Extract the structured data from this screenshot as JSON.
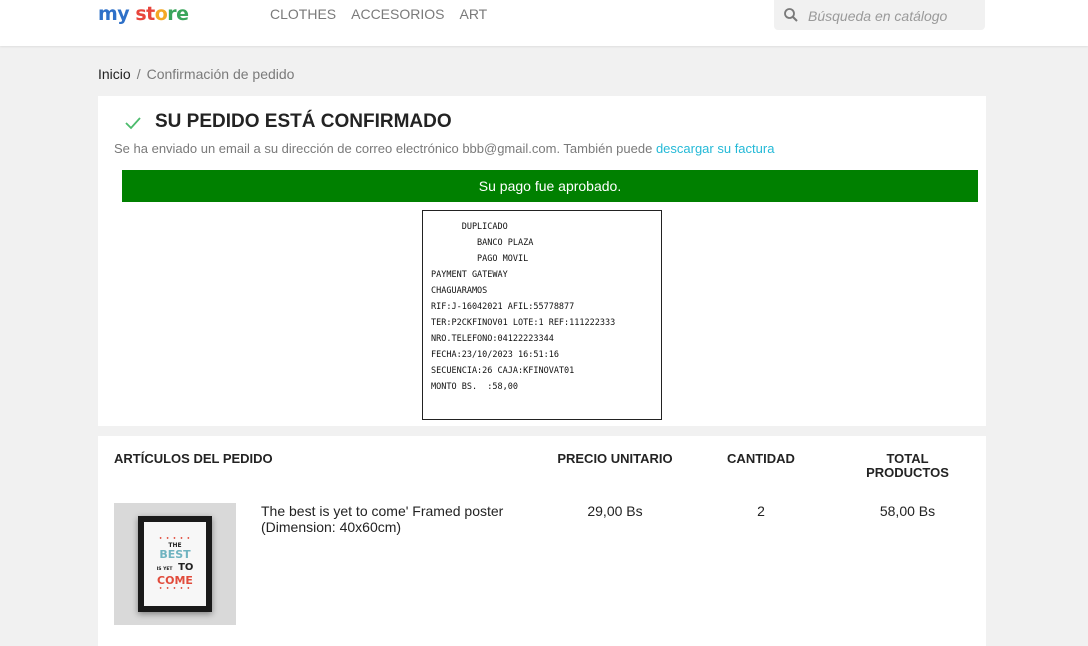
{
  "header": {
    "logo": {
      "part1": "my",
      "part2": "st",
      "part3": "o",
      "part4": "re"
    },
    "nav": [
      "CLOTHES",
      "ACCESORIOS",
      "ART"
    ],
    "search_placeholder": "Búsqueda en catálogo"
  },
  "breadcrumb": {
    "home": "Inicio",
    "current": "Confirmación de pedido"
  },
  "confirmation": {
    "title": "SU PEDIDO ESTÁ CONFIRMADO",
    "message": "Se ha enviado un email a su dirección de correo electrónico bbb@gmail.com. También puede ",
    "invoice_link": "descargar su factura",
    "payment_status": "Su pago fue aprobado."
  },
  "receipt": {
    "lines": [
      "      DUPLICADO",
      "         BANCO PLAZA",
      "         PAGO MOVIL",
      "PAYMENT GATEWAY",
      "CHAGUARAMOS",
      "RIF:J-16042021 AFIL:55778877",
      "TER:P2CKFINOV01 LOTE:1 REF:111222333",
      "NRO.TELEFONO:04122223344",
      "FECHA:23/10/2023 16:51:16",
      "SECUENCIA:26 CAJA:KFINOVAT01",
      "MONTO BS.  :58,00"
    ]
  },
  "order": {
    "headers": {
      "items": "ARTÍCULOS DEL PEDIDO",
      "unit_price": "PRECIO UNITARIO",
      "quantity": "CANTIDAD",
      "total_l1": "TOTAL",
      "total_l2": "PRODUCTOS"
    },
    "items": [
      {
        "name": "The best is yet to come' Framed poster (Dimension: 40x60cm)",
        "unit_price": "29,00 Bs",
        "quantity": "2",
        "total": "58,00 Bs",
        "poster_text": {
          "the": "THE",
          "best": "BEST",
          "is_yet": "IS YET",
          "to": "TO",
          "come": "COME"
        }
      }
    ]
  },
  "colors": {
    "approved_bg": "#008000",
    "link": "#24b9d7",
    "check": "#4cbb6c"
  }
}
